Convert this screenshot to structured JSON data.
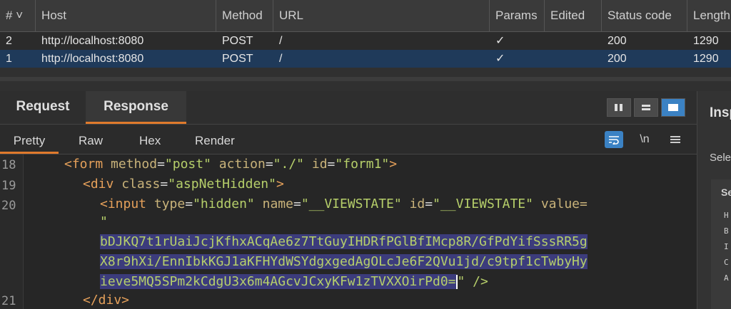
{
  "table": {
    "headers": [
      "#",
      "Host",
      "Method",
      "URL",
      "Params",
      "Edited",
      "Status code",
      "Length"
    ],
    "sort_indicator": "˅",
    "rows": [
      {
        "num": "2",
        "host": "http://localhost:8080",
        "method": "POST",
        "url": "/",
        "params": "✓",
        "edited": "",
        "status": "200",
        "length": "1290"
      },
      {
        "num": "1",
        "host": "http://localhost:8080",
        "method": "POST",
        "url": "/",
        "params": "✓",
        "edited": "",
        "status": "200",
        "length": "1290"
      }
    ],
    "selected_row": 1
  },
  "tabs": {
    "request": "Request",
    "response": "Response",
    "active": "Response"
  },
  "subtabs": {
    "pretty": "Pretty",
    "raw": "Raw",
    "hex": "Hex",
    "render": "Render",
    "active": "Pretty"
  },
  "editor_tools": {
    "wrap_icon": "wrap-icon",
    "newline_label": "\\n",
    "menu_icon": "menu-icon"
  },
  "code": {
    "line_numbers": [
      "18",
      "19",
      "20",
      "21"
    ],
    "line18": {
      "open": "<form",
      "a1": "method",
      "v1": "\"post\"",
      "a2": "action",
      "v2": "\"./\"",
      "a3": "id",
      "v3": "\"form1\"",
      "close": ">"
    },
    "line19": {
      "open": "<div",
      "a1": "class",
      "v1": "\"aspNetHidden\"",
      "close": ">"
    },
    "line20": {
      "open": "<input",
      "a1": "type",
      "v1": "\"hidden\"",
      "a2": "name",
      "v2": "\"__VIEWSTATE\"",
      "a3": "id",
      "v3": "\"__VIEWSTATE\"",
      "a4": "value=",
      "quote": "\""
    },
    "viewstate_lines": [
      "bDJKQ7t1rUaiJcjKfhxACqAe6z7TtGuyIHDRfPGlBfIMcp8R/GfPdYifSssRR5g",
      "X8r9hXi/EnnIbkKGJ1aKFHYdWSYdgxgedAgOLcJe6F2QVu1jd/c9tpf1cTwbyHy",
      "ieve5MQ5SPm2kCdgU3x6m4AGcvJCxyKFw1zTVXXOirPd0="
    ],
    "line20_end": "\" />",
    "line21": "</div>"
  },
  "inspector": {
    "title": "Insp",
    "sub": "Sele",
    "section": "Se",
    "mini": [
      "H",
      "B",
      "I",
      "C",
      "A"
    ]
  }
}
